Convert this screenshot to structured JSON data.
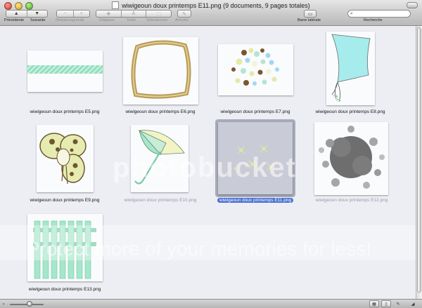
{
  "window": {
    "title": "wiwigeoun doux printemps E11.png (9 documents, 9 pages totales)"
  },
  "toolbar": {
    "prev_label": "Précédente",
    "next_label": "Suivante",
    "zoom_label": "Réduire/agrandir",
    "move_label": "Déplacer",
    "text_label": "Texte",
    "select_label": "Sélectionner",
    "annotate_label": "Annoter",
    "sidebar_label": "Barre latérale",
    "search_label": "Recherche"
  },
  "thumbnails": [
    {
      "caption": "wiwigeoun doux printemps E5.png",
      "state": "normal"
    },
    {
      "caption": "wiwigeoun doux printemps E6.png",
      "state": "normal"
    },
    {
      "caption": "wiwigeoun doux printemps E7.png",
      "state": "normal"
    },
    {
      "caption": "wiwigeoun doux printemps E8.png",
      "state": "normal"
    },
    {
      "caption": "wiwigeoun doux printemps E9.png",
      "state": "normal"
    },
    {
      "caption": "wiwigeoun doux printemps E10.png",
      "state": "normal"
    },
    {
      "caption": "wiwigeoun doux printemps E11.png",
      "state": "selected"
    },
    {
      "caption": "wiwigeoun doux printemps E12.png",
      "state": "normal"
    },
    {
      "caption": "wiwigeoun doux printemps E13.png",
      "state": "normal"
    }
  ],
  "watermark": {
    "brand": "photobucket",
    "tagline": "Protect more of your memories for less!"
  },
  "colors": {
    "mint": "#a6e6cb",
    "cream": "#f3f3c4",
    "selection": "#4a6fd0"
  }
}
